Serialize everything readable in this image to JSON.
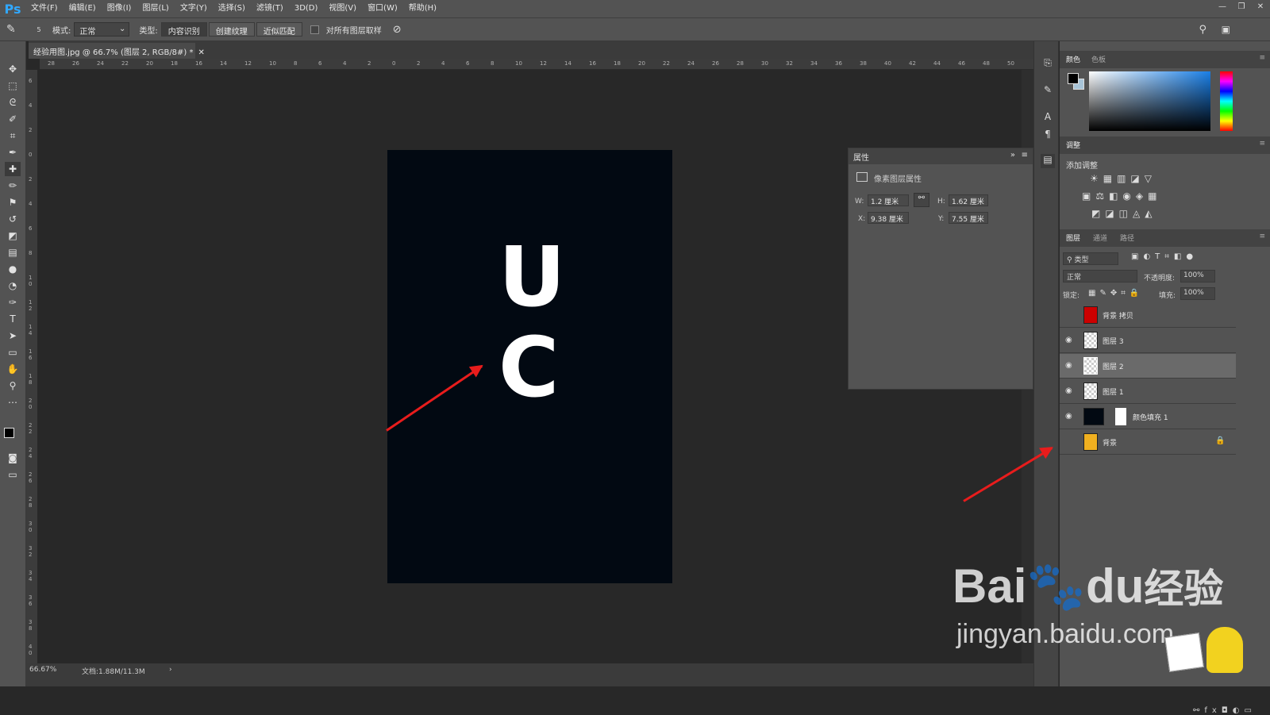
{
  "app": {
    "logo": "Ps"
  },
  "menu": [
    "文件(F)",
    "编辑(E)",
    "图像(I)",
    "图层(L)",
    "文字(Y)",
    "选择(S)",
    "滤镜(T)",
    "3D(D)",
    "视图(V)",
    "窗口(W)",
    "帮助(H)"
  ],
  "options": {
    "brush_size": "5",
    "mode_label": "模式:",
    "mode_value": "正常",
    "type_label": "类型:",
    "types": [
      "内容识别",
      "创建纹理",
      "近似匹配"
    ],
    "sample_all": "对所有图层取样"
  },
  "document": {
    "tab_title": "经验用图.jpg @ 66.7% (图层 2, RGB/8#) *",
    "zoom": "66.67%",
    "doc_size": "文档:1.88M/11.3M"
  },
  "ruler_h": [
    "28",
    "26",
    "24",
    "22",
    "20",
    "18",
    "16",
    "14",
    "12",
    "10",
    "8",
    "6",
    "4",
    "2",
    "0",
    "2",
    "4",
    "6",
    "8",
    "10",
    "12",
    "14",
    "16",
    "18",
    "20",
    "22",
    "24",
    "26",
    "28",
    "30",
    "32",
    "34",
    "36",
    "38",
    "40",
    "42",
    "44",
    "46",
    "48",
    "50"
  ],
  "ruler_v": [
    "6",
    "4",
    "2",
    "0",
    "2",
    "4",
    "6",
    "8",
    "1 0",
    "1 2",
    "1 4",
    "1 6",
    "1 8",
    "2 0",
    "2 2",
    "2 4",
    "2 6",
    "2 8",
    "3 0",
    "3 2",
    "3 4",
    "3 6",
    "3 8",
    "4 0"
  ],
  "canvas": {
    "letter1": "U",
    "letter2": "C",
    "bg": "#020912"
  },
  "properties": {
    "title": "属性",
    "subtitle": "像素图层属性",
    "w_label": "W:",
    "w_value": "1.2 厘米",
    "h_label": "H:",
    "h_value": "1.62 厘米",
    "x_label": "X:",
    "x_value": "9.38 厘米",
    "y_label": "Y:",
    "y_value": "7.55 厘米"
  },
  "color_panel": {
    "tabs": [
      "颜色",
      "色板"
    ]
  },
  "adjust_panel": {
    "title": "调整",
    "add_label": "添加调整"
  },
  "layers_panel": {
    "tabs": [
      "图层",
      "通道",
      "路径"
    ],
    "filter": "类型",
    "blend": "正常",
    "opacity_label": "不透明度:",
    "opacity": "100%",
    "lock_label": "锁定:",
    "fill_label": "填充:",
    "fill": "100%",
    "layers": [
      {
        "name": "背景 拷贝",
        "visible": false
      },
      {
        "name": "图层 3",
        "visible": true
      },
      {
        "name": "图层 2",
        "visible": true,
        "selected": true
      },
      {
        "name": "图层 1",
        "visible": true
      },
      {
        "name": "颜色填充 1",
        "visible": true
      },
      {
        "name": "背景",
        "visible": false
      }
    ]
  },
  "watermark": {
    "brand": "Bai",
    "brand2": "du",
    "brand3": "经验",
    "url": "jingyan.baidu.com"
  },
  "colors": {
    "accent": "#31a8ff",
    "arrow": "#e81c1c"
  }
}
